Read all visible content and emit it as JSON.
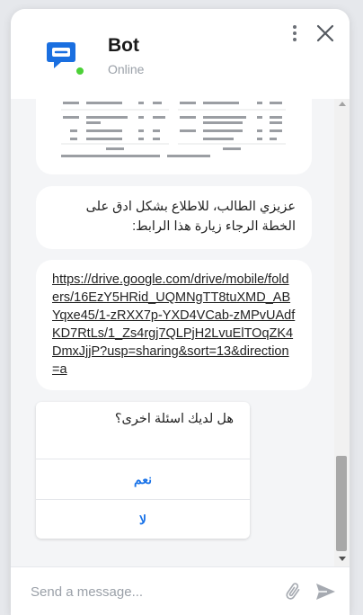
{
  "header": {
    "bot_name": "Bot",
    "status": "Online"
  },
  "messages": {
    "intro_arabic": "عزيزي الطالب، للاطلاع بشكل ادق على الخطة الرجاء زيارة هذا الرابط:",
    "link_url": "https://drive.google.com/drive/mobile/folders/16EzY5HRid_UQMNgTT8tuXMD_ABYqxe45/1-zRXX7p-YXD4VCab-zMPvUAdfKD7RtLs/1_Zs4rgj7QLPjH2LvuElTOqZK4DmxJjjP?usp=sharing&sort=13&direction=a"
  },
  "card": {
    "question": "هل لديك اسئلة اخرى؟",
    "yes_label": "نعم",
    "no_label": "لا"
  },
  "composer": {
    "placeholder": "Send a message..."
  },
  "colors": {
    "brand": "#1a73e8",
    "online": "#4cd137"
  }
}
